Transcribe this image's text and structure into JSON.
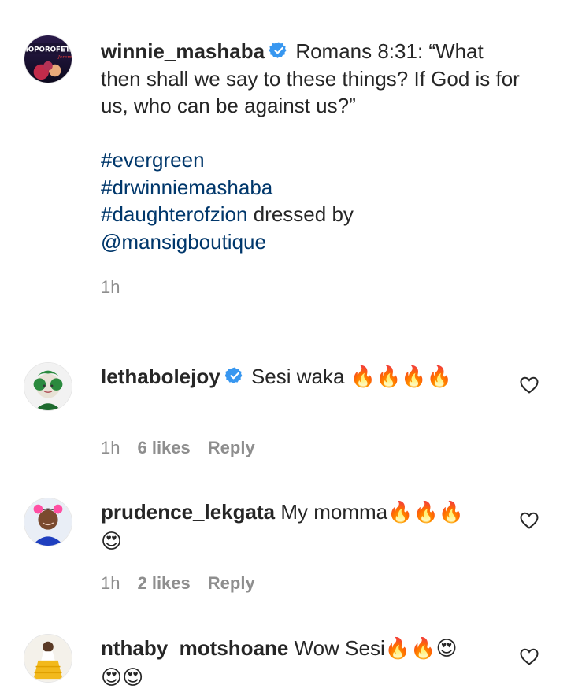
{
  "post": {
    "username": "winnie_mashaba",
    "caption_main": "Romans 8:31: “What then shall we say to these things? If God is for us, who can be against us?”",
    "hashtags": [
      "#evergreen",
      "#drwinniemashaba",
      "#daughterofzion"
    ],
    "dressed_by_text": "dressed by",
    "mention": "@mansigboutique",
    "time": "1h",
    "avatar_text": "MOPOROFETA"
  },
  "comments": [
    {
      "username": "lethabolejoy",
      "verified": true,
      "text": "Sesi waka",
      "emojis": "🔥🔥🔥🔥",
      "time": "1h",
      "likes": "6 likes",
      "reply": "Reply"
    },
    {
      "username": "prudence_lekgata",
      "verified": false,
      "text": "My momma",
      "emojis": "🔥🔥🔥😍",
      "time": "1h",
      "likes": "2 likes",
      "reply": "Reply"
    },
    {
      "username": "nthaby_motshoane",
      "verified": false,
      "text": "Wow Sesi",
      "emojis": "🔥🔥😍😍😍",
      "time": "",
      "likes": "",
      "reply": ""
    }
  ],
  "colors": {
    "text": "#262626",
    "meta": "#8e8e8e",
    "link": "#00376b",
    "verified": "#3897f0",
    "divider": "#dbdbdb",
    "fire": "#ff7a00",
    "heart_eyes": "#ffcc33"
  },
  "icons": {
    "verified": "verified-badge-icon",
    "like": "heart-outline-icon",
    "fire": "fire-emoji",
    "heart_eyes": "heart-eyes-emoji"
  }
}
